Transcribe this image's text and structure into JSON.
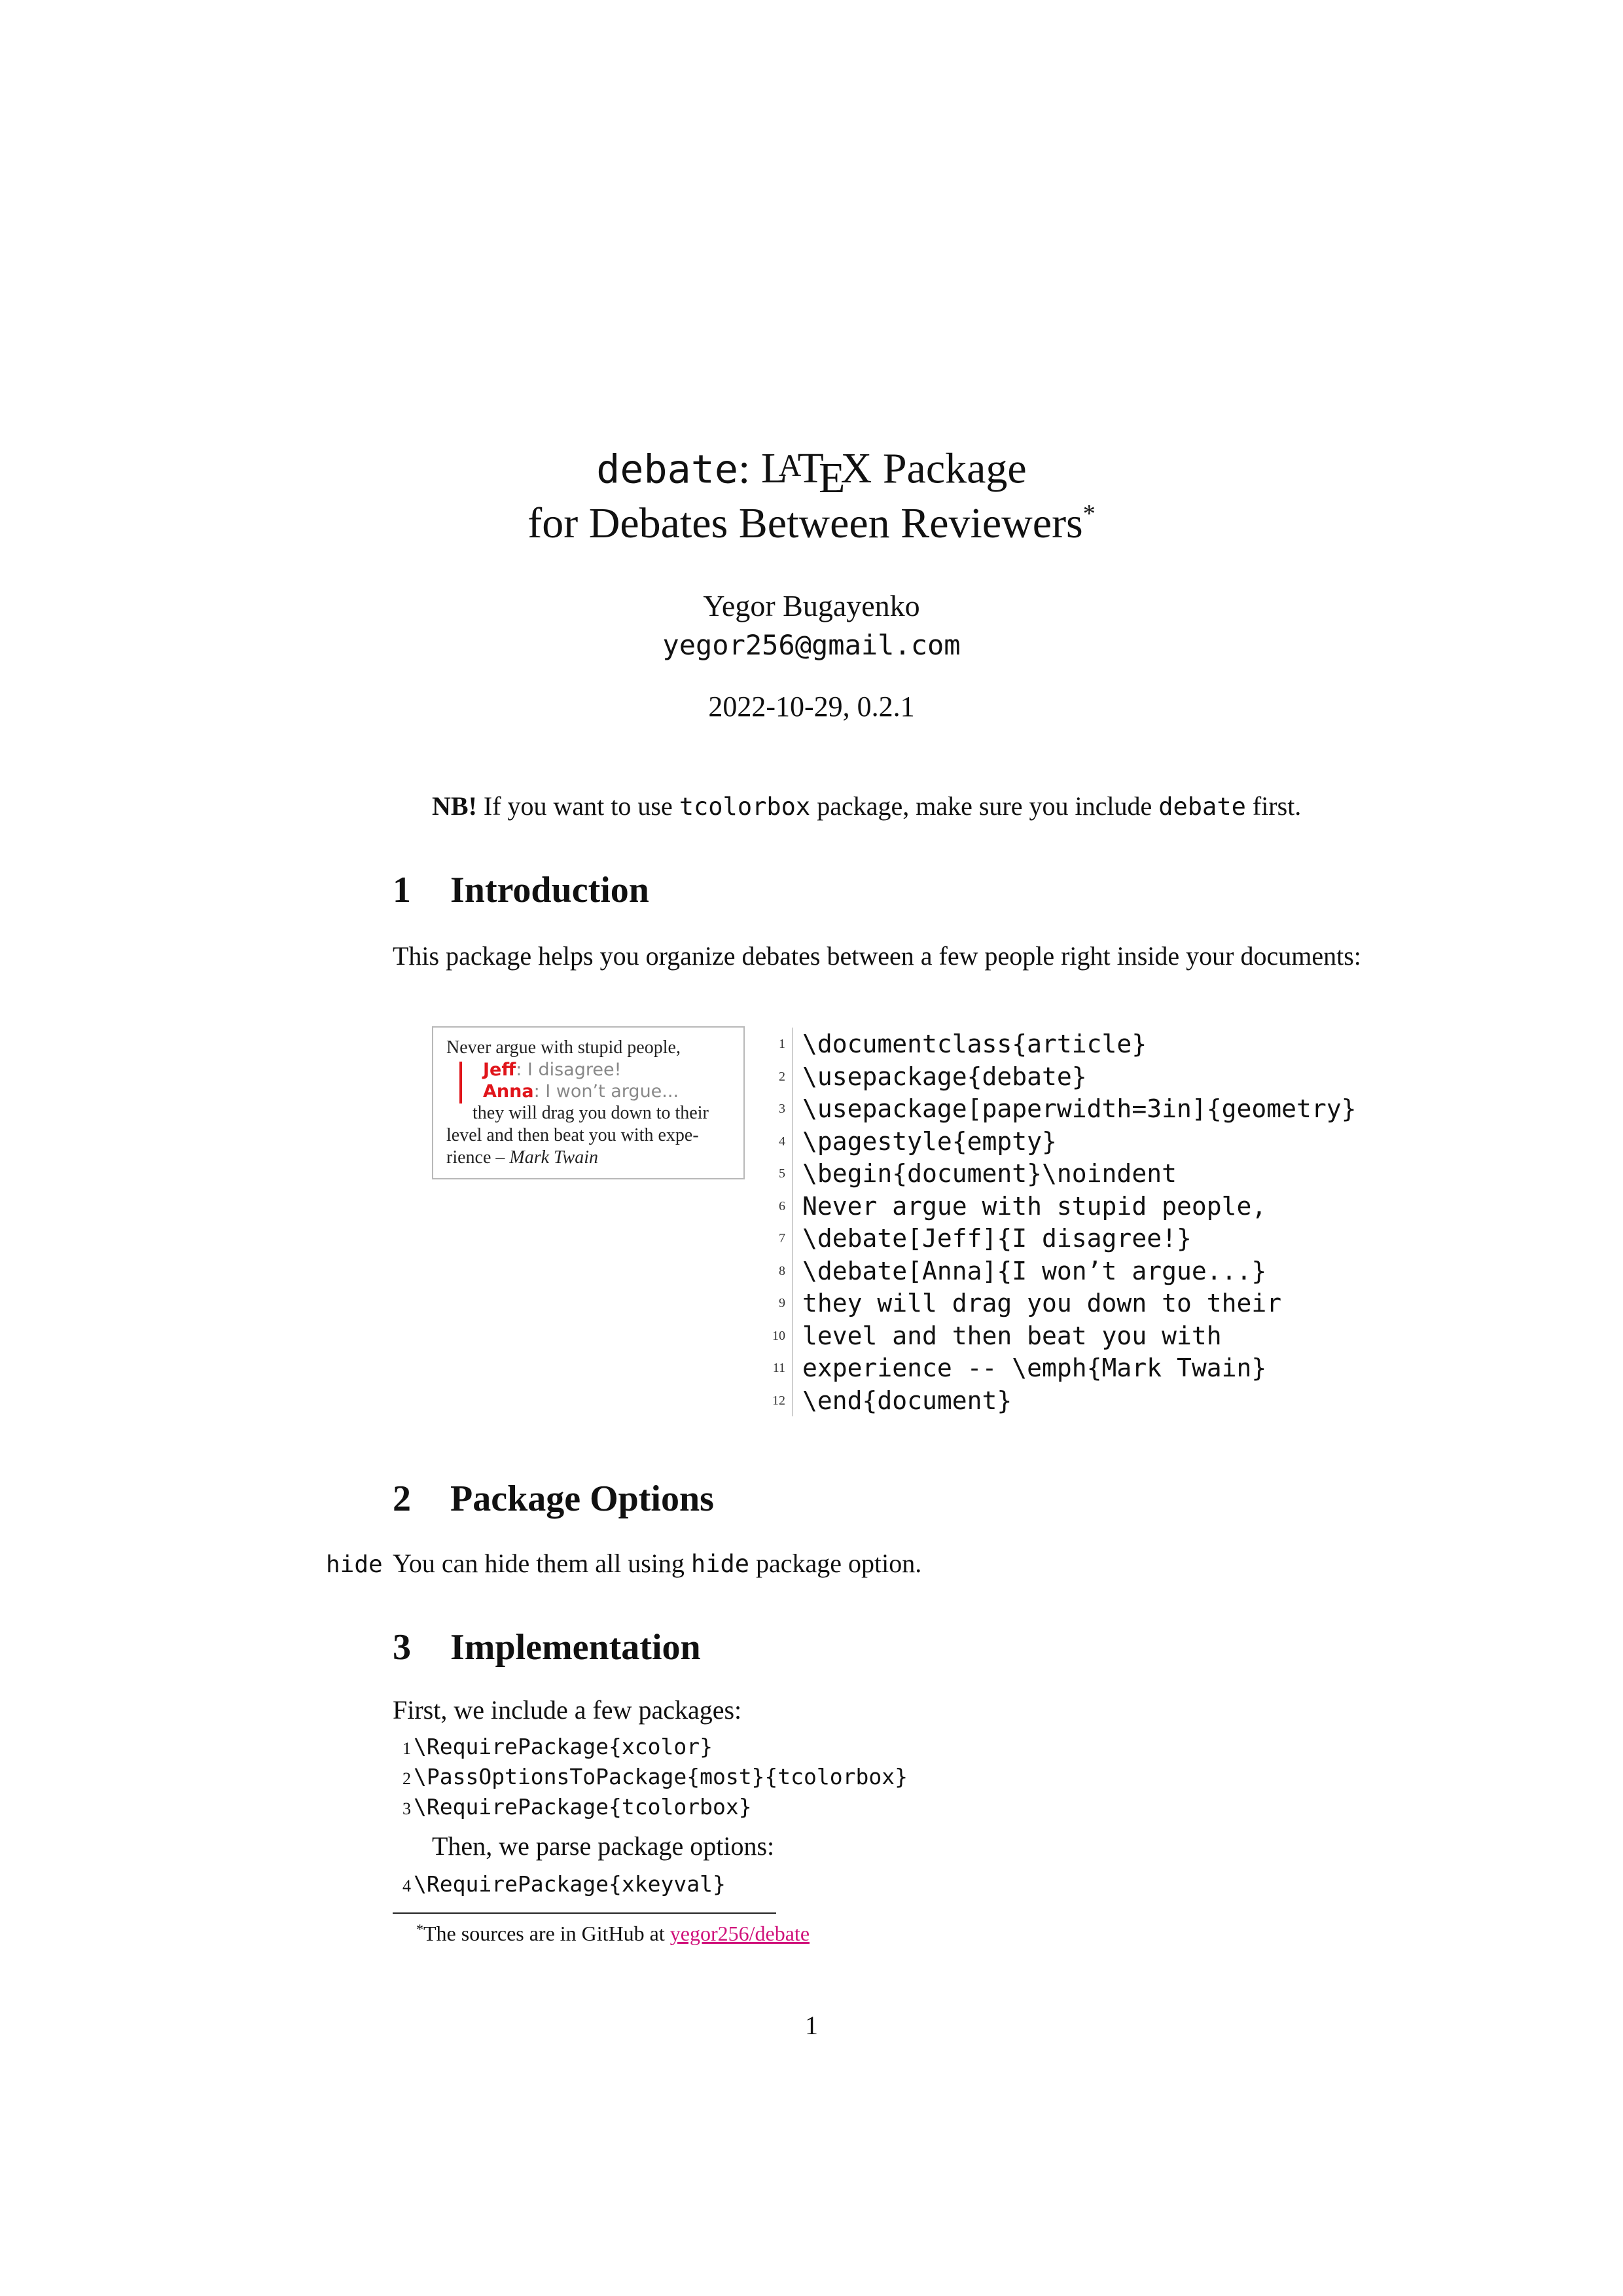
{
  "title": {
    "pkg": "debate",
    "colon": ":",
    "latex_L": "L",
    "latex_A": "A",
    "latex_T": "T",
    "latex_E": "E",
    "latex_X": "X",
    "line1_rest": " Package",
    "line2": "for Debates Between Reviewers",
    "footnote_mark": "*"
  },
  "author": {
    "name": "Yegor Bugayenko",
    "email": "yegor256@gmail.com",
    "date": "2022-10-29, 0.2.1"
  },
  "nb": {
    "bold": "NB!",
    "t1": " If you want to use ",
    "code1": "tcolorbox",
    "t2": " package, make sure you include ",
    "code2": "debate",
    "t3": " first."
  },
  "sections": {
    "intro": {
      "num": "1",
      "title": "Introduction"
    },
    "options": {
      "num": "2",
      "title": "Package Options"
    },
    "impl": {
      "num": "3",
      "title": "Implementation"
    }
  },
  "intro_text": "This package helps you organize debates between a few people right inside your documents:",
  "example": {
    "line1": "Never argue with stupid people,",
    "debates": [
      {
        "who": "Jeff",
        "text": ": I disagree!"
      },
      {
        "who": "Anna",
        "text": ": I won’t argue..."
      }
    ],
    "line2": "they will drag you down to their",
    "line3": "level and then beat you with expe-",
    "line4_pre": "rience – ",
    "line4_em": "Mark Twain"
  },
  "listing": [
    {
      "n": "1",
      "code": "\\documentclass{article}"
    },
    {
      "n": "2",
      "code": "\\usepackage{debate}"
    },
    {
      "n": "3",
      "code": "\\usepackage[paperwidth=3in]{geometry}"
    },
    {
      "n": "4",
      "code": "\\pagestyle{empty}"
    },
    {
      "n": "5",
      "code": "\\begin{document}\\noindent"
    },
    {
      "n": "6",
      "code": "Never argue with stupid people,"
    },
    {
      "n": "7",
      "code": "\\debate[Jeff]{I disagree!}"
    },
    {
      "n": "8",
      "code": "\\debate[Anna]{I won’t argue...}"
    },
    {
      "n": "9",
      "code": "they will drag you down to their"
    },
    {
      "n": "10",
      "code": "level and then beat you with"
    },
    {
      "n": "11",
      "code": "experience -- \\emph{Mark Twain}"
    },
    {
      "n": "12",
      "code": "\\end{document}"
    }
  ],
  "options": {
    "margin_label": "hide",
    "t1": "You can hide them all using ",
    "code": "hide",
    "t2": " package option."
  },
  "impl": {
    "intro": "First, we include a few packages:",
    "code1": [
      {
        "n": "1",
        "code": "\\RequirePackage{xcolor}"
      },
      {
        "n": "2",
        "code": "\\PassOptionsToPackage{most}{tcolorbox}"
      },
      {
        "n": "3",
        "code": "\\RequirePackage{tcolorbox}"
      }
    ],
    "then": "Then, we parse package options:",
    "code2": [
      {
        "n": "4",
        "code": "\\RequirePackage{xkeyval}"
      }
    ]
  },
  "footnote": {
    "mark": "*",
    "text": "The sources are in GitHub at ",
    "link": "yegor256/debate"
  },
  "page_number": "1"
}
